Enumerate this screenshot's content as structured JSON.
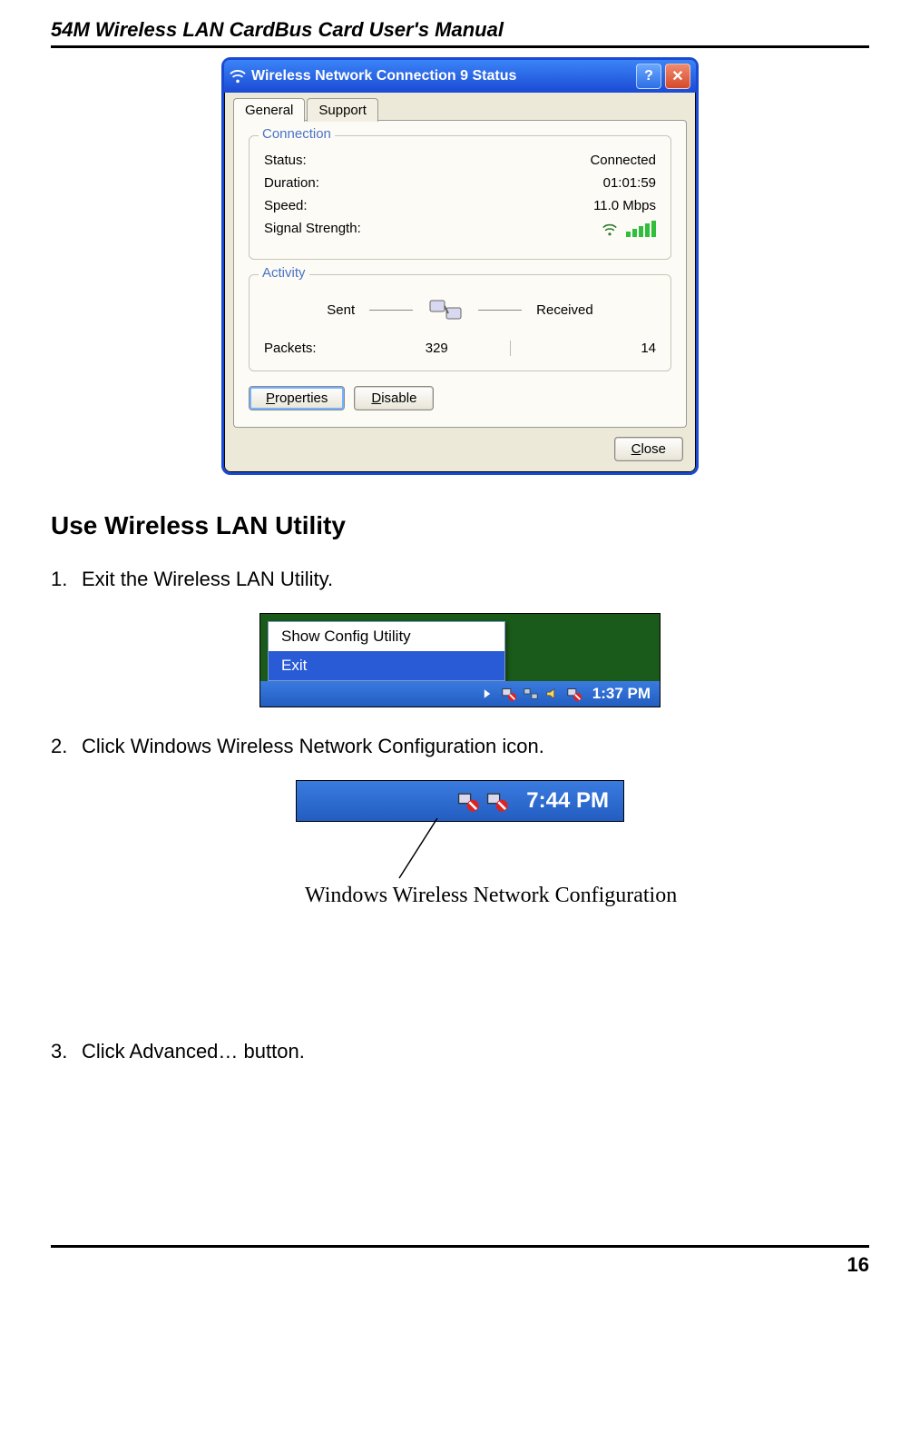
{
  "header": {
    "title": "54M Wireless LAN CardBus Card User's Manual"
  },
  "dialog": {
    "title": "Wireless Network Connection 9 Status",
    "tabs": {
      "general": "General",
      "support": "Support"
    },
    "connection": {
      "group_label": "Connection",
      "status_label": "Status:",
      "status_value": "Connected",
      "duration_label": "Duration:",
      "duration_value": "01:01:59",
      "speed_label": "Speed:",
      "speed_value": "11.0 Mbps",
      "signal_label": "Signal Strength:"
    },
    "activity": {
      "group_label": "Activity",
      "sent_label": "Sent",
      "received_label": "Received",
      "packets_label": "Packets:",
      "packets_sent": "329",
      "packets_received": "14"
    },
    "buttons": {
      "properties_pre": "",
      "properties_u": "P",
      "properties_post": "roperties",
      "disable_pre": "",
      "disable_u": "D",
      "disable_post": "isable",
      "close_pre": "",
      "close_u": "C",
      "close_post": "lose"
    }
  },
  "section": {
    "title": "Use Wireless LAN Utility"
  },
  "steps": {
    "s1_num": "1.",
    "s1": "Exit the Wireless LAN Utility.",
    "s2_num": "2.",
    "s2": "Click Windows Wireless Network Configuration icon.",
    "s3_num": "3.",
    "s3": "Click Advanced… button."
  },
  "context_menu": {
    "item1": "Show Config Utility",
    "item2": "Exit",
    "time": "1:37 PM"
  },
  "taskbar2": {
    "time": "7:44 PM"
  },
  "callout": {
    "label": "Windows Wireless Network Configuration"
  },
  "footer": {
    "page_number": "16"
  }
}
